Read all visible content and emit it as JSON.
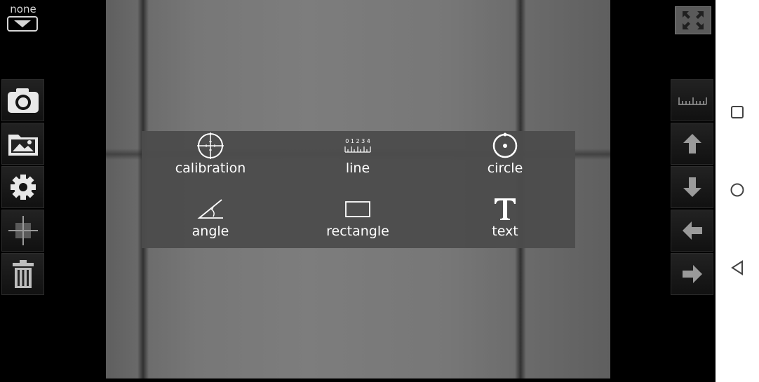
{
  "top_left": {
    "mode_label": "none"
  },
  "left_toolbar": [
    {
      "name": "camera-button",
      "icon": "camera-icon"
    },
    {
      "name": "gallery-button",
      "icon": "image-folder-icon"
    },
    {
      "name": "settings-button",
      "icon": "gear-icon"
    },
    {
      "name": "crosshair-button",
      "icon": "crosshair-icon"
    },
    {
      "name": "delete-button",
      "icon": "trash-icon"
    }
  ],
  "right_toolbar": [
    {
      "name": "ruler-button",
      "icon": "ruler-icon"
    },
    {
      "name": "move-up-button",
      "icon": "arrow-up-icon"
    },
    {
      "name": "move-down-button",
      "icon": "arrow-down-icon"
    },
    {
      "name": "move-left-button",
      "icon": "arrow-left-icon"
    },
    {
      "name": "move-right-button",
      "icon": "arrow-right-icon"
    }
  ],
  "measure_menu": {
    "items": [
      {
        "label": "calibration",
        "icon": "calibration-reticle-icon"
      },
      {
        "label": "line",
        "icon": "ruler-scale-icon"
      },
      {
        "label": "circle",
        "icon": "circle-icon"
      },
      {
        "label": "angle",
        "icon": "angle-icon"
      },
      {
        "label": "rectangle",
        "icon": "rectangle-icon"
      },
      {
        "label": "text",
        "icon": "text-icon"
      }
    ],
    "ruler_digits": "0 1 2 3 4"
  },
  "nav_bar": {
    "icons": [
      "recent-apps-icon",
      "home-icon",
      "back-icon"
    ]
  },
  "colors": {
    "panel": "#4c4c4c",
    "toolbar": "#111111",
    "nav_bar": "#ffffff"
  }
}
